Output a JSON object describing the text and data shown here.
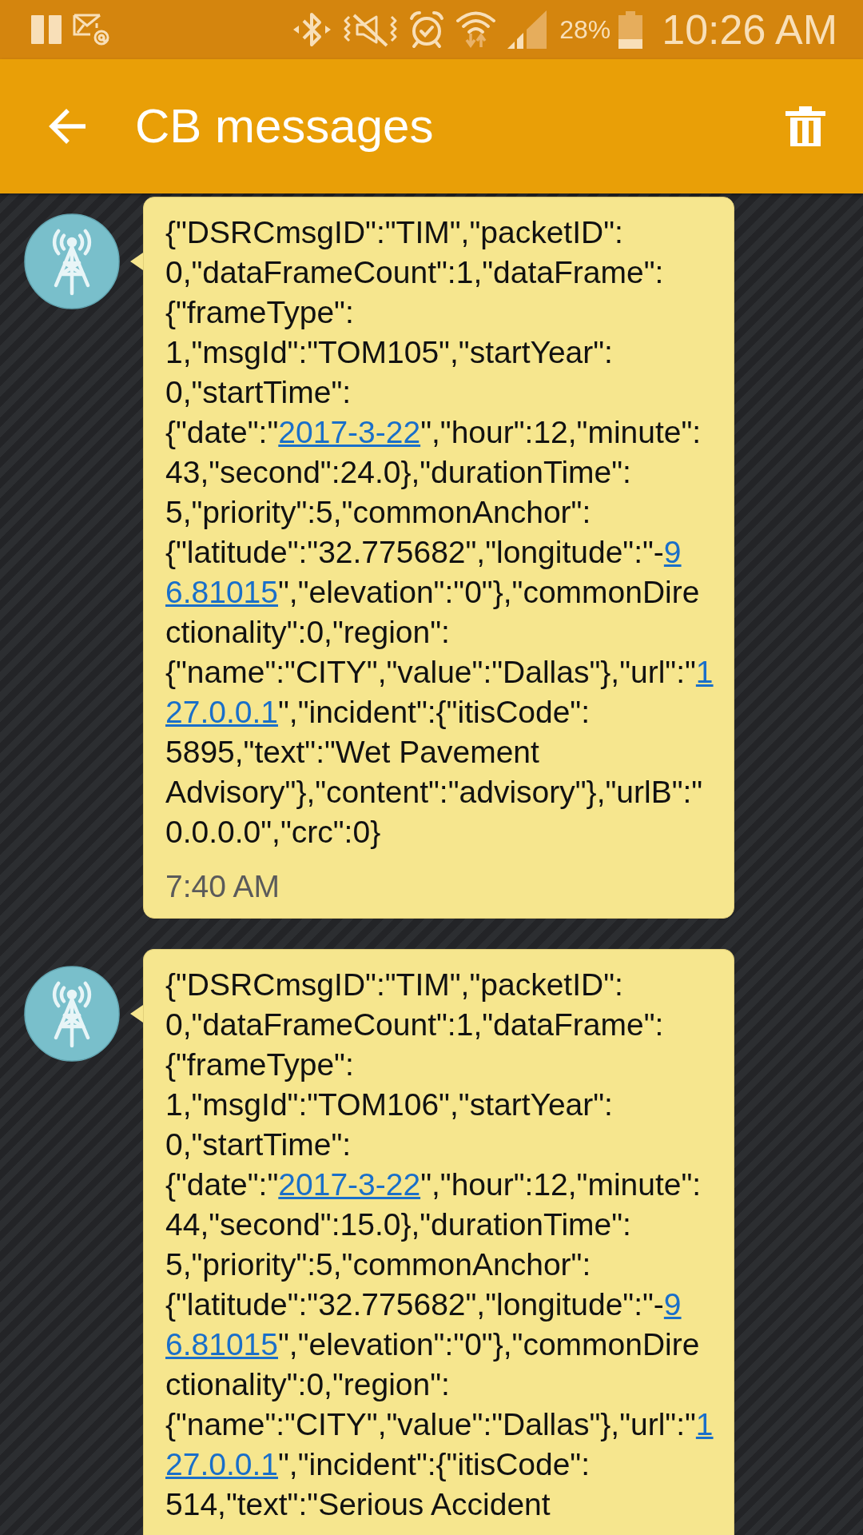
{
  "status_bar": {
    "battery_percent": "28%",
    "time": "10:26 AM"
  },
  "app_bar": {
    "title": "CB messages"
  },
  "messages": [
    {
      "lines": [
        [
          {
            "kind": "text",
            "text": "{\"DSRCmsgID\":\"TIM\",\"packetID\":"
          }
        ],
        [
          {
            "kind": "text",
            "text": "0,\"dataFrameCount\":1,\"dataFrame\":"
          }
        ],
        [
          {
            "kind": "text",
            "text": "{\"frameType\":"
          }
        ],
        [
          {
            "kind": "text",
            "text": "1,\"msgId\":\"TOM105\",\"startYear\":"
          }
        ],
        [
          {
            "kind": "text",
            "text": "0,\"startTime\":"
          }
        ],
        [
          {
            "kind": "text",
            "text": "{\"date\":\""
          },
          {
            "kind": "link",
            "text": "2017-3-22"
          },
          {
            "kind": "text",
            "text": "\",\"hour\":12,\"minute\":"
          }
        ],
        [
          {
            "kind": "text",
            "text": "43,\"second\":24.0},\"durationTime\":"
          }
        ],
        [
          {
            "kind": "text",
            "text": "5,\"priority\":5,\"commonAnchor\":"
          }
        ],
        [
          {
            "kind": "text",
            "text": "{\"latitude\":\"32.775682\",\"longitude\":\"-"
          },
          {
            "kind": "link",
            "text": "9"
          }
        ],
        [
          {
            "kind": "link",
            "text": "6.81015"
          },
          {
            "kind": "text",
            "text": "\",\"elevation\":\"0\"},\"commonDire"
          }
        ],
        [
          {
            "kind": "text",
            "text": "ctionality\":0,\"region\":"
          }
        ],
        [
          {
            "kind": "text",
            "text": "{\"name\":\"CITY\",\"value\":\"Dallas\"},\"url\":\""
          },
          {
            "kind": "link",
            "text": "1"
          }
        ],
        [
          {
            "kind": "link",
            "text": "27.0.0.1"
          },
          {
            "kind": "text",
            "text": "\",\"incident\":{\"itisCode\":"
          }
        ],
        [
          {
            "kind": "text",
            "text": "5895,\"text\":\"Wet Pavement"
          }
        ],
        [
          {
            "kind": "text",
            "text": "Advisory\"},\"content\":\"advisory\"},\"urlB\":\""
          }
        ],
        [
          {
            "kind": "text",
            "text": "0.0.0.0\",\"crc\":0}"
          }
        ]
      ],
      "time": "7:40 AM"
    },
    {
      "lines": [
        [
          {
            "kind": "text",
            "text": "{\"DSRCmsgID\":\"TIM\",\"packetID\":"
          }
        ],
        [
          {
            "kind": "text",
            "text": "0,\"dataFrameCount\":1,\"dataFrame\":"
          }
        ],
        [
          {
            "kind": "text",
            "text": "{\"frameType\":"
          }
        ],
        [
          {
            "kind": "text",
            "text": "1,\"msgId\":\"TOM106\",\"startYear\":"
          }
        ],
        [
          {
            "kind": "text",
            "text": "0,\"startTime\":"
          }
        ],
        [
          {
            "kind": "text",
            "text": "{\"date\":\""
          },
          {
            "kind": "link",
            "text": "2017-3-22"
          },
          {
            "kind": "text",
            "text": "\",\"hour\":12,\"minute\":"
          }
        ],
        [
          {
            "kind": "text",
            "text": "44,\"second\":15.0},\"durationTime\":"
          }
        ],
        [
          {
            "kind": "text",
            "text": "5,\"priority\":5,\"commonAnchor\":"
          }
        ],
        [
          {
            "kind": "text",
            "text": "{\"latitude\":\"32.775682\",\"longitude\":\"-"
          },
          {
            "kind": "link",
            "text": "9"
          }
        ],
        [
          {
            "kind": "link",
            "text": "6.81015"
          },
          {
            "kind": "text",
            "text": "\",\"elevation\":\"0\"},\"commonDire"
          }
        ],
        [
          {
            "kind": "text",
            "text": "ctionality\":0,\"region\":"
          }
        ],
        [
          {
            "kind": "text",
            "text": "{\"name\":\"CITY\",\"value\":\"Dallas\"},\"url\":\""
          },
          {
            "kind": "link",
            "text": "1"
          }
        ],
        [
          {
            "kind": "link",
            "text": "27.0.0.1"
          },
          {
            "kind": "text",
            "text": "\",\"incident\":{\"itisCode\":"
          }
        ],
        [
          {
            "kind": "text",
            "text": "514,\"text\":\"Serious Accident"
          }
        ]
      ]
    }
  ]
}
